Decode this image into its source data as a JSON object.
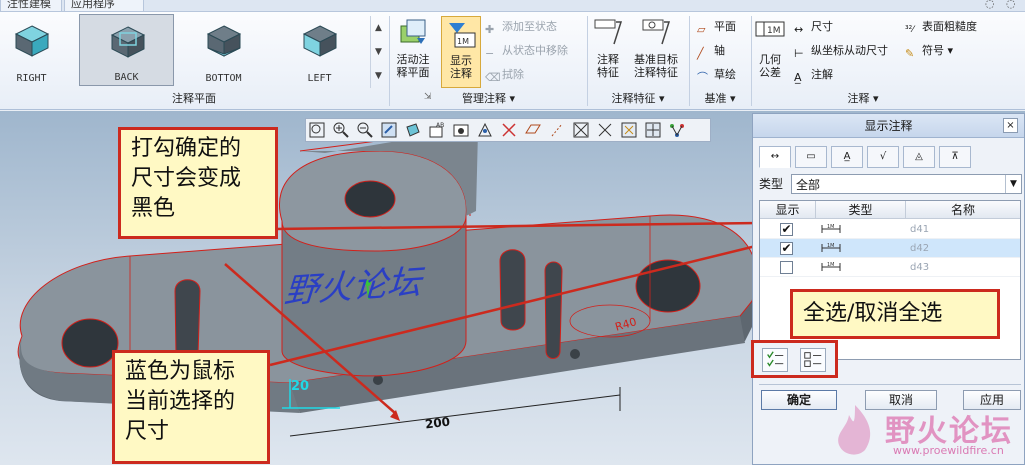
{
  "tabs": [
    "注性建模",
    "应用程序"
  ],
  "ribbon": {
    "gallery": {
      "items": [
        "RIGHT",
        "BACK",
        "BOTTOM",
        "LEFT"
      ],
      "selected_index": 1,
      "group_label": "注释平面"
    },
    "activate_plane": "活动注\n释平面",
    "show_annotation": "显示\n注释",
    "add_to_state": "添加至状态",
    "remove_from_state": "从状态中移除",
    "erase": "拭除",
    "manage_group": "管理注释",
    "annotation_feature": "注释\n特征",
    "datum_target_feature": "基准目标\n注释特征",
    "annotation_feature_group": "注释特征",
    "plane": "平面",
    "axis": "轴",
    "sketch": "草绘",
    "datum_group": "基准",
    "geometric_tolerance": "几何\n公差",
    "dimension": "尺寸",
    "ordinate_dimension": "纵坐标从动尺寸",
    "note": "注解",
    "surface_roughness": "表面粗糙度",
    "symbol": "符号",
    "annotation_group": "注释"
  },
  "viewport": {
    "callout_1": "打勾确定的\n尺寸会变成\n黑色",
    "callout_2": "蓝色为鼠标\n当前选择的\n尺寸",
    "callout_3": "全选/取消全选",
    "text_3d": "野火论坛",
    "dim_radius": "R40",
    "dim_height": "20",
    "dim_length": "200"
  },
  "dialog": {
    "title": "显示注释",
    "close": "×",
    "type_label": "类型",
    "type_value": "全部",
    "columns": [
      "显示",
      "类型",
      "名称"
    ],
    "rows": [
      {
        "checked": true,
        "name": "d41"
      },
      {
        "checked": true,
        "name": "d42"
      },
      {
        "checked": false,
        "name": "d43"
      }
    ],
    "ok": "确定",
    "cancel": "取消",
    "apply": "应用"
  },
  "watermark": {
    "text": "野火论坛",
    "url": "www.proewildfire.cn"
  },
  "colors": {
    "callout_border": "#cc2a1e",
    "callout_bg": "#fff9c4",
    "model_gray": "#7e8891",
    "model_edge": "#d2201a",
    "selected_dim": "#1fd9e6",
    "highlight_row": "#cfe6fb"
  }
}
